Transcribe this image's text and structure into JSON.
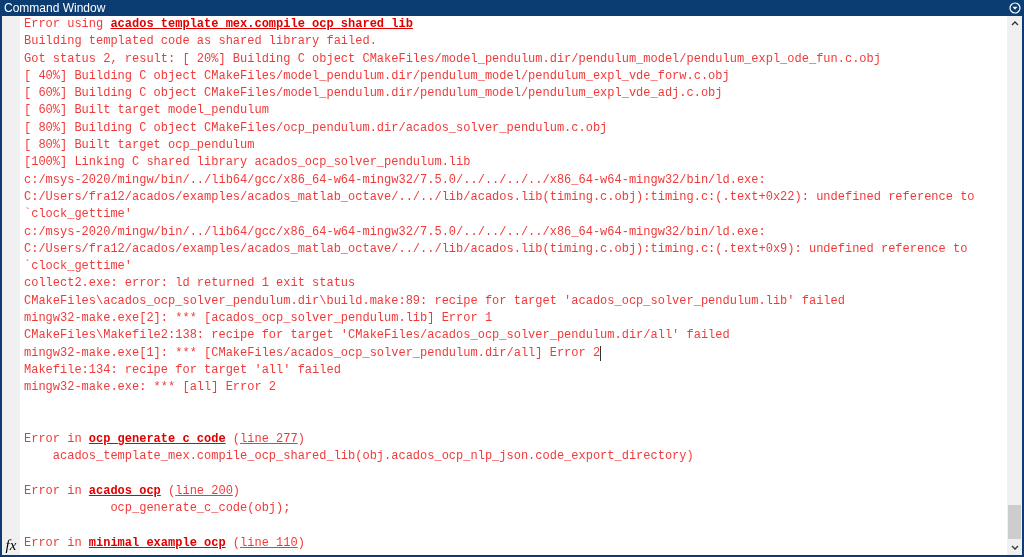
{
  "window": {
    "title": "Command Window"
  },
  "prompt_icon": "fx",
  "lines": [
    {
      "kind": "text",
      "caret": false,
      "segments": [
        {
          "kind": "plain",
          "text": "Error using "
        },
        {
          "kind": "link",
          "text": "acados_template_mex.compile_ocp_shared_lib"
        }
      ]
    },
    {
      "kind": "text",
      "caret": false,
      "segments": [
        {
          "kind": "plain",
          "text": "Building templated code as shared library failed."
        }
      ]
    },
    {
      "kind": "text",
      "caret": false,
      "segments": [
        {
          "kind": "plain",
          "text": "Got status 2, result: [ 20%] Building C object CMakeFiles/model_pendulum.dir/pendulum_model/pendulum_expl_ode_fun.c.obj"
        }
      ]
    },
    {
      "kind": "text",
      "caret": false,
      "segments": [
        {
          "kind": "plain",
          "text": "[ 40%] Building C object CMakeFiles/model_pendulum.dir/pendulum_model/pendulum_expl_vde_forw.c.obj"
        }
      ]
    },
    {
      "kind": "text",
      "caret": false,
      "segments": [
        {
          "kind": "plain",
          "text": "[ 60%] Building C object CMakeFiles/model_pendulum.dir/pendulum_model/pendulum_expl_vde_adj.c.obj"
        }
      ]
    },
    {
      "kind": "text",
      "caret": false,
      "segments": [
        {
          "kind": "plain",
          "text": "[ 60%] Built target model_pendulum"
        }
      ]
    },
    {
      "kind": "text",
      "caret": false,
      "segments": [
        {
          "kind": "plain",
          "text": "[ 80%] Building C object CMakeFiles/ocp_pendulum.dir/acados_solver_pendulum.c.obj"
        }
      ]
    },
    {
      "kind": "text",
      "caret": false,
      "segments": [
        {
          "kind": "plain",
          "text": "[ 80%] Built target ocp_pendulum"
        }
      ]
    },
    {
      "kind": "text",
      "caret": false,
      "segments": [
        {
          "kind": "plain",
          "text": "[100%] Linking C shared library acados_ocp_solver_pendulum.lib"
        }
      ]
    },
    {
      "kind": "text",
      "caret": false,
      "segments": [
        {
          "kind": "plain",
          "text": "c:/msys-2020/mingw/bin/../lib64/gcc/x86_64-w64-mingw32/7.5.0/../../../../x86_64-w64-mingw32/bin/ld.exe:"
        }
      ]
    },
    {
      "kind": "text",
      "caret": false,
      "segments": [
        {
          "kind": "plain",
          "text": "C:/Users/fra12/acados/examples/acados_matlab_octave/../../lib/acados.lib(timing.c.obj):timing.c:(.text+0x22): undefined reference to"
        }
      ]
    },
    {
      "kind": "text",
      "caret": false,
      "segments": [
        {
          "kind": "plain",
          "text": "`clock_gettime'"
        }
      ]
    },
    {
      "kind": "text",
      "caret": false,
      "segments": [
        {
          "kind": "plain",
          "text": "c:/msys-2020/mingw/bin/../lib64/gcc/x86_64-w64-mingw32/7.5.0/../../../../x86_64-w64-mingw32/bin/ld.exe:"
        }
      ]
    },
    {
      "kind": "text",
      "caret": false,
      "segments": [
        {
          "kind": "plain",
          "text": "C:/Users/fra12/acados/examples/acados_matlab_octave/../../lib/acados.lib(timing.c.obj):timing.c:(.text+0x9): undefined reference to"
        }
      ]
    },
    {
      "kind": "text",
      "caret": false,
      "segments": [
        {
          "kind": "plain",
          "text": "`clock_gettime'"
        }
      ]
    },
    {
      "kind": "text",
      "caret": false,
      "segments": [
        {
          "kind": "plain",
          "text": "collect2.exe: error: ld returned 1 exit status"
        }
      ]
    },
    {
      "kind": "text",
      "caret": false,
      "segments": [
        {
          "kind": "plain",
          "text": "CMakeFiles\\acados_ocp_solver_pendulum.dir\\build.make:89: recipe for target 'acados_ocp_solver_pendulum.lib' failed"
        }
      ]
    },
    {
      "kind": "text",
      "caret": false,
      "segments": [
        {
          "kind": "plain",
          "text": "mingw32-make.exe[2]: *** [acados_ocp_solver_pendulum.lib] Error 1"
        }
      ]
    },
    {
      "kind": "text",
      "caret": false,
      "segments": [
        {
          "kind": "plain",
          "text": "CMakeFiles\\Makefile2:138: recipe for target 'CMakeFiles/acados_ocp_solver_pendulum.dir/all' failed"
        }
      ]
    },
    {
      "kind": "text",
      "caret": true,
      "segments": [
        {
          "kind": "plain",
          "text": "mingw32-make.exe[1]: *** [CMakeFiles/acados_ocp_solver_pendulum.dir/all] Error 2"
        }
      ]
    },
    {
      "kind": "text",
      "caret": false,
      "segments": [
        {
          "kind": "plain",
          "text": "Makefile:134: recipe for target 'all' failed"
        }
      ]
    },
    {
      "kind": "text",
      "caret": false,
      "segments": [
        {
          "kind": "plain",
          "text": "mingw32-make.exe: *** [all] Error 2"
        }
      ]
    },
    {
      "kind": "blank"
    },
    {
      "kind": "blank"
    },
    {
      "kind": "text",
      "caret": false,
      "segments": [
        {
          "kind": "plain",
          "text": "Error in "
        },
        {
          "kind": "link",
          "text": "ocp_generate_c_code"
        },
        {
          "kind": "plain",
          "text": " ("
        },
        {
          "kind": "line-link",
          "text": "line 277"
        },
        {
          "kind": "plain",
          "text": ")"
        }
      ]
    },
    {
      "kind": "text",
      "caret": false,
      "segments": [
        {
          "kind": "plain",
          "text": "    acados_template_mex.compile_ocp_shared_lib(obj.acados_ocp_nlp_json.code_export_directory)"
        }
      ]
    },
    {
      "kind": "blank"
    },
    {
      "kind": "text",
      "caret": false,
      "segments": [
        {
          "kind": "plain",
          "text": "Error in "
        },
        {
          "kind": "link",
          "text": "acados_ocp"
        },
        {
          "kind": "plain",
          "text": " ("
        },
        {
          "kind": "line-link",
          "text": "line 200"
        },
        {
          "kind": "plain",
          "text": ")"
        }
      ]
    },
    {
      "kind": "text",
      "caret": false,
      "segments": [
        {
          "kind": "plain",
          "text": "            ocp_generate_c_code(obj);"
        }
      ]
    },
    {
      "kind": "blank"
    },
    {
      "kind": "text",
      "caret": false,
      "segments": [
        {
          "kind": "plain",
          "text": "Error in "
        },
        {
          "kind": "link",
          "text": "minimal_example_ocp"
        },
        {
          "kind": "plain",
          "text": " ("
        },
        {
          "kind": "line-link",
          "text": "line 110"
        },
        {
          "kind": "plain",
          "text": ")"
        }
      ]
    }
  ]
}
